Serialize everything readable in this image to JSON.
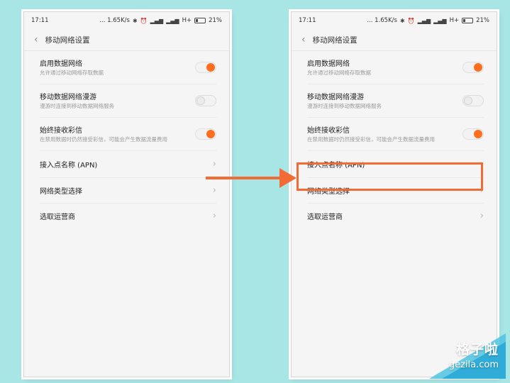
{
  "statusbar": {
    "time": "17:11",
    "speed": "... 1.65K/s",
    "network": "H+",
    "battery": "21%"
  },
  "header": {
    "title": "移动网络设置"
  },
  "settings": [
    {
      "label": "启用数据网络",
      "sub": "允许通过移动网络存取数据",
      "toggle": "on"
    },
    {
      "label": "移动数据网络漫游",
      "sub": "漫游时连接到移动数据网络服务",
      "toggle": "off"
    },
    {
      "label": "始终接收彩信",
      "sub": "在禁用数据时仍然接受彩信，可能会产生数据流量费用",
      "toggle": "on"
    }
  ],
  "nav_items": [
    {
      "label": "接入点名称 (APN)"
    },
    {
      "label": "网络类型选择"
    },
    {
      "label": "选取运营商"
    }
  ],
  "watermark": {
    "title": "格子啦",
    "url": "gezila.com"
  },
  "colors": {
    "accent": "#ff6e1c",
    "highlight": "#f26b35",
    "background": "#a8e6e6"
  }
}
